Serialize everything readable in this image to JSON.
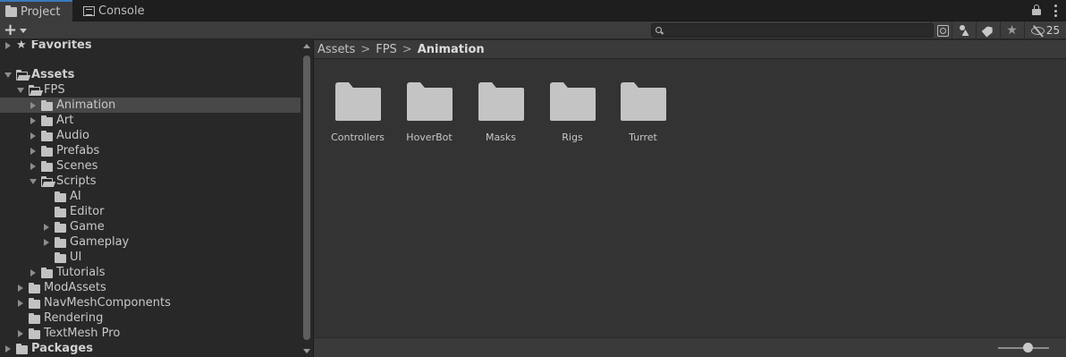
{
  "tabs": [
    {
      "label": "Project",
      "icon": "folder-icon",
      "active": true
    },
    {
      "label": "Console",
      "icon": "console-icon",
      "active": false
    }
  ],
  "toolbar": {
    "create_label": "+",
    "search_value": "",
    "hidden_count": "25"
  },
  "tree": {
    "favorites": "Favorites",
    "assets": "Assets",
    "fps": "FPS",
    "animation": "Animation",
    "art": "Art",
    "audio": "Audio",
    "prefabs": "Prefabs",
    "scenes": "Scenes",
    "scripts": "Scripts",
    "ai": "AI",
    "editor": "Editor",
    "game": "Game",
    "gameplay": "Gameplay",
    "ui": "UI",
    "tutorials": "Tutorials",
    "modassets": "ModAssets",
    "navmesh": "NavMeshComponents",
    "rendering": "Rendering",
    "textmesh": "TextMesh Pro",
    "packages": "Packages"
  },
  "breadcrumb": {
    "items": [
      "Assets",
      "FPS"
    ],
    "current": "Animation",
    "separator": ">"
  },
  "grid_items": [
    "Controllers",
    "HoverBot",
    "Masks",
    "Rigs",
    "Turret"
  ],
  "colors": {
    "accent": "#3a79bb",
    "selection": "#484848",
    "panel": "#333333"
  },
  "zoom_level": 0.5
}
